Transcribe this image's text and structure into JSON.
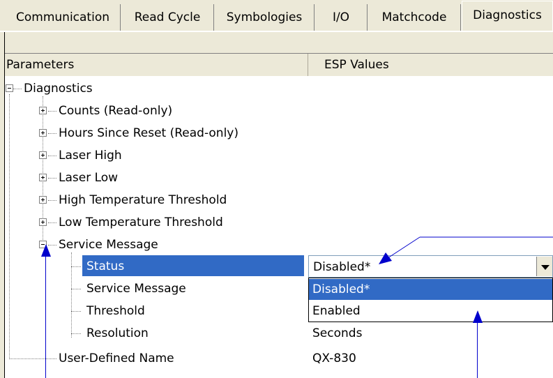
{
  "tabs": [
    {
      "label": "Communication"
    },
    {
      "label": "Read Cycle"
    },
    {
      "label": "Symbologies"
    },
    {
      "label": "I/O"
    },
    {
      "label": "Matchcode"
    },
    {
      "label": "Diagnostics",
      "active": true
    }
  ],
  "columns": {
    "parameters": "Parameters",
    "values": "ESP Values"
  },
  "tree": {
    "root": "Diagnostics",
    "items": [
      {
        "label": "Counts (Read-only)"
      },
      {
        "label": "Hours Since Reset (Read-only)"
      },
      {
        "label": "Laser High"
      },
      {
        "label": "Laser Low"
      },
      {
        "label": "High Temperature Threshold"
      },
      {
        "label": "Low Temperature Threshold"
      },
      {
        "label": "Service Message"
      }
    ],
    "service_children": [
      {
        "label": "Status",
        "value": "Disabled*"
      },
      {
        "label": "Service Message",
        "value": ""
      },
      {
        "label": "Threshold",
        "value": ""
      },
      {
        "label": "Resolution",
        "value": "Seconds"
      }
    ],
    "last": {
      "label": "User-Defined Name",
      "value": "QX-830"
    }
  },
  "dropdown": {
    "selected": "Disabled*",
    "options": [
      "Disabled*",
      "Enabled"
    ]
  },
  "colors": {
    "selection": "#316ac5",
    "callout": "#0000cc"
  }
}
